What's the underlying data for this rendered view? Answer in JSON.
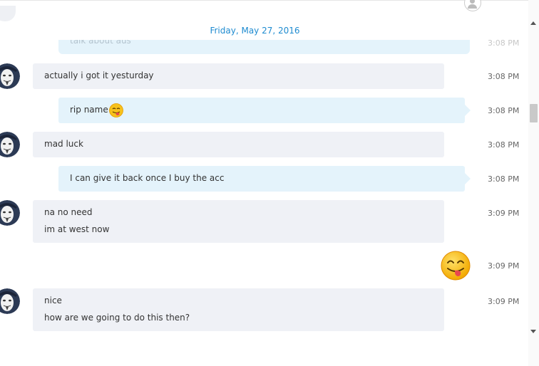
{
  "date_header": "Friday, May 27, 2016",
  "faded_message": {
    "text": "talk about aus",
    "time": "3:08 PM"
  },
  "messages": [
    {
      "direction": "in",
      "lines": [
        "actually i got it yesturday"
      ],
      "time": "3:08 PM"
    },
    {
      "direction": "out",
      "lines": [
        "rip name"
      ],
      "emoji": "grin-tongue-emoji",
      "time": "3:08 PM"
    },
    {
      "direction": "in",
      "lines": [
        "mad luck"
      ],
      "time": "3:08 PM"
    },
    {
      "direction": "out",
      "lines": [
        "I can give it back once I buy the acc"
      ],
      "time": "3:08 PM"
    },
    {
      "direction": "in",
      "lines": [
        "na no need",
        "im at west now"
      ],
      "time": "3:09 PM"
    },
    {
      "direction": "out",
      "emoji_only": "grin-tongue-emoji",
      "time": "3:09 PM"
    },
    {
      "direction": "in",
      "lines": [
        "nice",
        "how are we going to do this then?"
      ],
      "time": "3:09 PM"
    }
  ],
  "icons": {
    "avatar": "anonymous-mask-avatar",
    "presence": "contact-presence-icon",
    "scroll_up": "chevron-up-icon",
    "scroll_down": "chevron-down-icon"
  },
  "colors": {
    "incoming_bubble": "#eff1f6",
    "outgoing_bubble": "#e4f3fb",
    "date_header": "#1e8bd0"
  }
}
